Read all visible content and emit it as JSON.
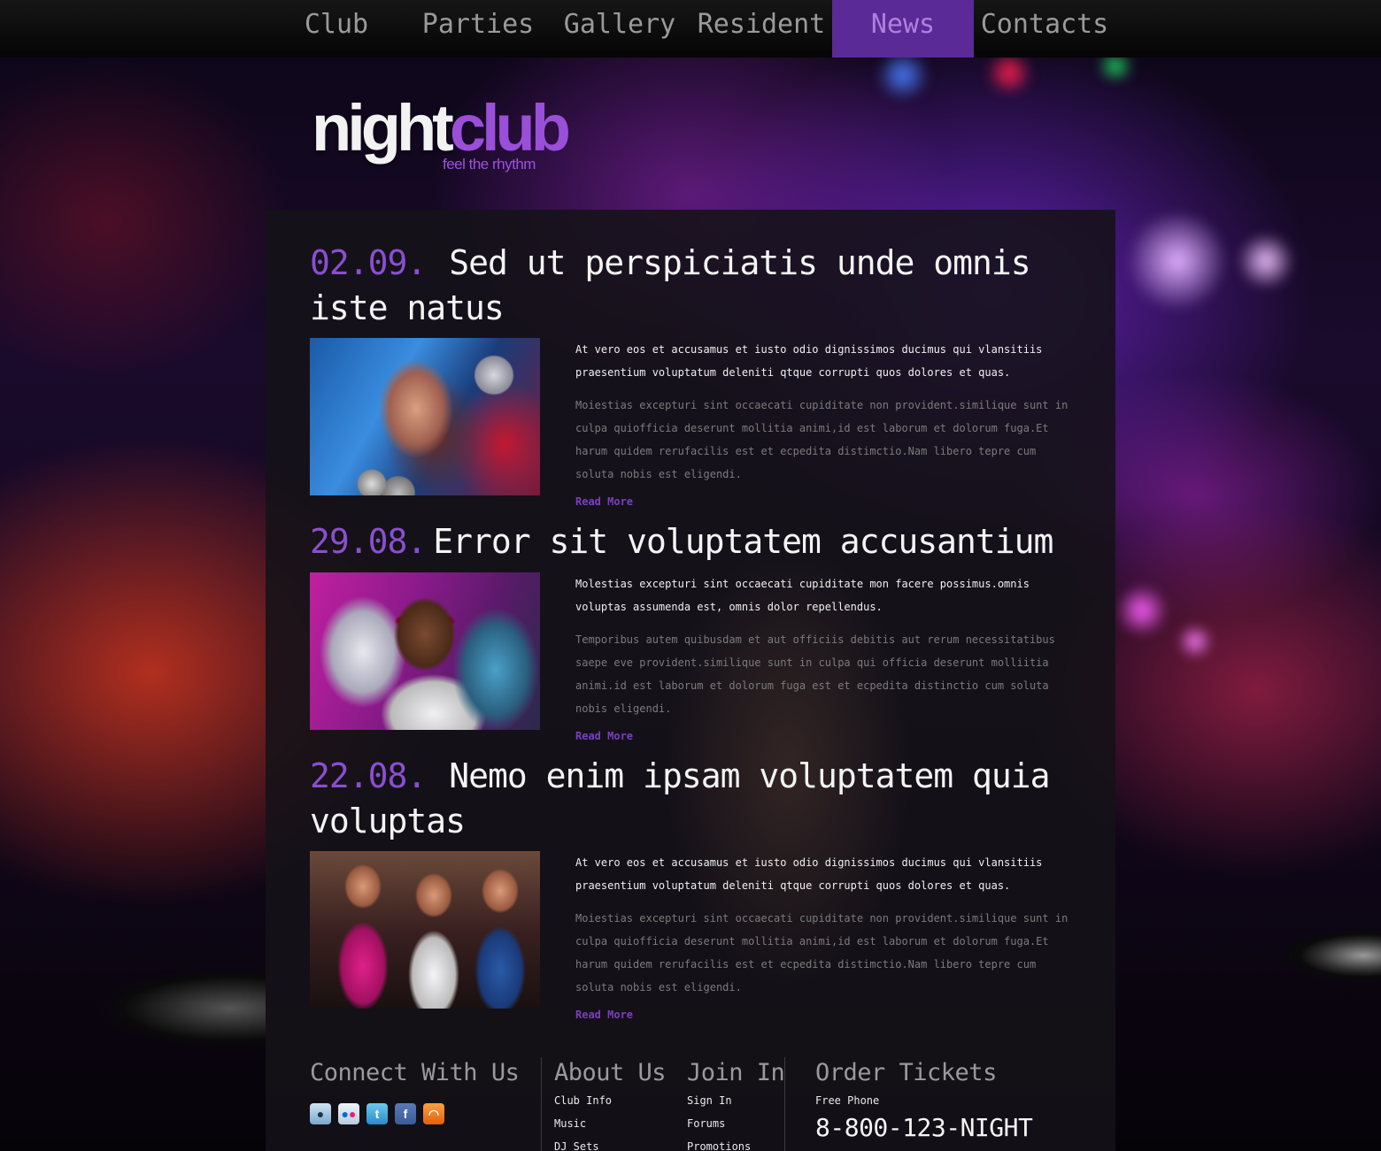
{
  "nav": {
    "items": [
      {
        "label": "Club"
      },
      {
        "label": "Parties"
      },
      {
        "label": "Gallery"
      },
      {
        "label": "Resident"
      },
      {
        "label": "News"
      },
      {
        "label": "Contacts"
      }
    ],
    "active": "News"
  },
  "logo": {
    "word_night": "night",
    "word_club": "club",
    "tagline": "feel the rhythm"
  },
  "articles": [
    {
      "date": "02.09.",
      "title": "Sed ut perspiciatis unde omnis iste natus",
      "lead": "At vero eos et accusamus et iusto odio dignissimos ducimus qui vlansitiis praesentium voluptatum deleniti qtque corrupti quos dolores et quas.",
      "body": "Moiestias excepturi sint occaecati cupiditate non provident.similique sunt in culpa quiofficia deserunt mollitia animi,id est laborum et dolorum fuga.Et harum quidem rerufacilis est et ecpedita distimctio.Nam libero tepre cum soluta nobis est eligendi.",
      "read_more": "Read More",
      "image": "woman-with-disco-balls-photo"
    },
    {
      "date": "29.08.",
      "title": "Error sit voluptatem accusantium",
      "lead": "Molestias excepturi sint occaecati cupiditate mon facere possimus.omnis voluptas assumenda est, omnis dolor repellendus.",
      "body": "Temporibus autem quibusdam et aut officiis debitis aut rerum necessitatibus saepe eve provident.similique sunt in culpa qui officia deserunt molliitia animi.id est laborum et dolorum fuga est et ecpedita distinctio cum soluta nobis eligendi.",
      "read_more": "Read More",
      "image": "man-in-sunglasses-dancing-photo"
    },
    {
      "date": "22.08.",
      "title": "Nemo enim ipsam voluptatem quia voluptas",
      "lead": "At vero eos et accusamus et iusto odio dignissimos ducimus qui vlansitiis praesentium voluptatum deleniti qtque corrupti quos dolores et quas.",
      "body": "Moiestias excepturi sint occaecati cupiditate non provident.similique sunt in culpa quiofficia deserunt mollitia animi,id est laborum et dolorum fuga.Et harum quidem rerufacilis est et ecpedita distimctio.Nam libero tepre cum soluta nobis est eligendi.",
      "read_more": "Read More",
      "image": "three-girls-dancing-photo"
    }
  ],
  "footer": {
    "connect": {
      "title": "Connect With Us",
      "icons": [
        "reddit-icon",
        "flickr-icon",
        "twitter-icon",
        "facebook-icon",
        "rss-icon"
      ]
    },
    "about": {
      "title": "About Us",
      "links": [
        "Club Info",
        "Music",
        "DJ Sets"
      ]
    },
    "join": {
      "title": "Join In",
      "links": [
        "Sign In",
        "Forums",
        "Promotions"
      ]
    },
    "tickets": {
      "title": "Order Tickets",
      "phone_label": "Free Phone",
      "phone": "8-800-123-NIGHT"
    }
  },
  "colors": {
    "accent": "#8a4fd0",
    "nav_active_bg": "#5a2a96",
    "panel_bg": "#141218",
    "text_muted": "#7b7b7b"
  }
}
